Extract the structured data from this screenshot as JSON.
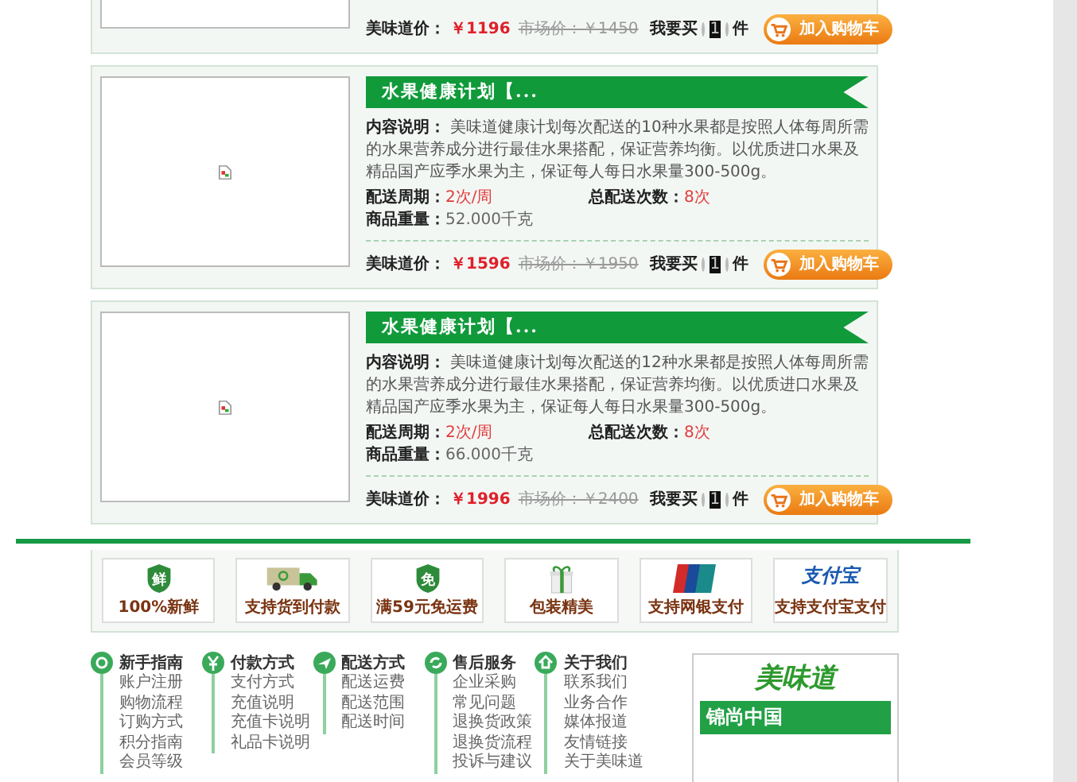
{
  "top_product": {
    "price_label": "美味道价：",
    "price": "￥1196",
    "market_price": "市场价：￥1450",
    "buy_label": "我要买",
    "quantity": "1",
    "unit": "件",
    "cart_button": "加入购物车"
  },
  "products": [
    {
      "title": "水果健康计划【...",
      "description": "**内容说明：** 美味道健康计划每次配送的10种水果都是按照人体每周所需的水果营养成分进行最佳水果搭配，保证营养均衡。以优质进口水果及精品国产应季水果为主，保证每人每日水果量300-500g。",
      "cycle_label": "配送周期：",
      "cycle": "2次/周",
      "total_label": "总配送次数：",
      "total": "8次",
      "weight_label": "商品重量：",
      "weight": "52.000千克",
      "price_label": "美味道价：",
      "price": "￥1596",
      "market_price": "市场价：￥1950",
      "buy_label": "我要买",
      "quantity": "1",
      "unit": "件",
      "cart_button": "加入购物车"
    },
    {
      "title": "水果健康计划【...",
      "description": "**内容说明：** 美味道健康计划每次配送的12种水果都是按照人体每周所需的水果营养成分进行最佳水果搭配，保证营养均衡。以优质进口水果及精品国产应季水果为主，保证每人每日水果量300-500g。",
      "cycle_label": "配送周期：",
      "cycle": "2次/周",
      "total_label": "总配送次数：",
      "total": "8次",
      "weight_label": "商品重量：",
      "weight": "66.000千克",
      "price_label": "美味道价：",
      "price": "￥1996",
      "market_price": "市场价：￥2400",
      "buy_label": "我要买",
      "quantity": "1",
      "unit": "件",
      "cart_button": "加入购物车"
    }
  ],
  "services": [
    {
      "kind": "fresh",
      "badge_text": "鲜",
      "label": "100%新鲜"
    },
    {
      "kind": "truck",
      "label": "支持货到付款"
    },
    {
      "kind": "free",
      "badge_text": "免",
      "label": "满59元免运费"
    },
    {
      "kind": "gift",
      "label": "包装精美"
    },
    {
      "kind": "unionpay",
      "label": "支持网银支付"
    },
    {
      "kind": "alipay",
      "badge_text": "支付宝",
      "label": "支持支付宝支付"
    }
  ],
  "footer_columns": [
    {
      "kind": "guide",
      "title": "新手指南",
      "links": [
        "账户注册",
        "购物流程",
        "订购方式",
        "积分指南",
        "会员等级"
      ]
    },
    {
      "kind": "payment",
      "title": "付款方式",
      "links": [
        "支付方式",
        "充值说明",
        "充值卡说明",
        "礼品卡说明"
      ]
    },
    {
      "kind": "delivery",
      "title": "配送方式",
      "links": [
        "配送运费",
        "配送范围",
        "配送时间"
      ]
    },
    {
      "kind": "service",
      "title": "售后服务",
      "links": [
        "企业采购",
        "常见问题",
        "退换货政策",
        "退换货流程",
        "投诉与建议"
      ]
    },
    {
      "kind": "about",
      "title": "关于我们",
      "links": [
        "联系我们",
        "业务合作",
        "媒体报道",
        "友情链接",
        "关于美味道"
      ]
    }
  ],
  "banner": {
    "logo": "美味道",
    "slogan": "锦尚中国"
  }
}
